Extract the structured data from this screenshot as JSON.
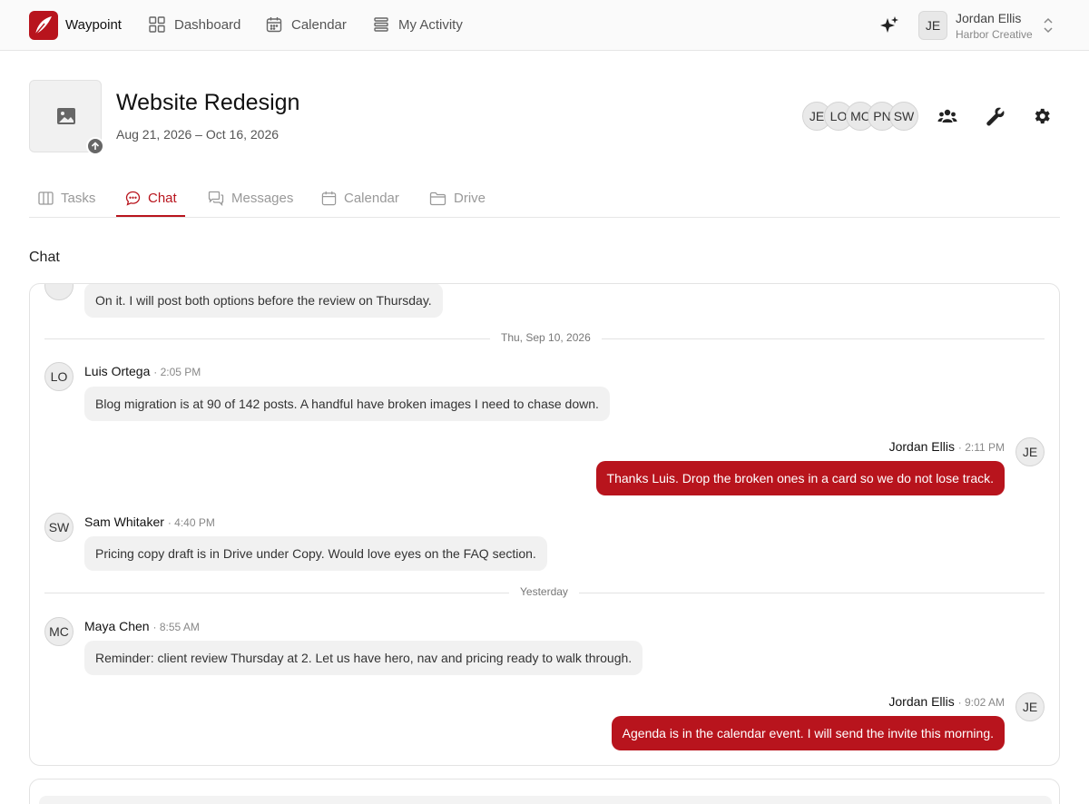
{
  "app": {
    "brand": "Waypoint",
    "accent_color": "#b8141d"
  },
  "nav": {
    "items": [
      {
        "label": "Dashboard",
        "icon": "grid-icon"
      },
      {
        "label": "Calendar",
        "icon": "calendar-icon"
      },
      {
        "label": "My Activity",
        "icon": "list-icon"
      }
    ]
  },
  "user": {
    "initials": "JE",
    "name": "Jordan Ellis",
    "org": "Harbor Creative"
  },
  "project": {
    "title": "Website Redesign",
    "dates": "Aug 21, 2026 – Oct 16, 2026",
    "members": [
      "JE",
      "LO",
      "MC",
      "PN",
      "SW"
    ]
  },
  "tabs": [
    {
      "label": "Tasks",
      "icon": "columns-icon",
      "active": false
    },
    {
      "label": "Chat",
      "icon": "chat-icon",
      "active": true
    },
    {
      "label": "Messages",
      "icon": "messages-icon",
      "active": false
    },
    {
      "label": "Calendar",
      "icon": "calendar-icon",
      "active": false
    },
    {
      "label": "Drive",
      "icon": "folder-icon",
      "active": false
    }
  ],
  "chat": {
    "section_title": "Chat",
    "dates": [
      "Thu, Sep 10, 2026",
      "Yesterday"
    ],
    "messages": [
      {
        "initials": "",
        "name": "",
        "time": "",
        "text": "On it. I will post both options before the review on Thursday.",
        "outgoing": false
      },
      {
        "initials": "LO",
        "name": "Luis Ortega",
        "time": "· 2:05 PM",
        "text": "Blog migration is at 90 of 142 posts. A handful have broken images I need to chase down.",
        "outgoing": false
      },
      {
        "initials": "JE",
        "name": "Jordan Ellis",
        "time": "· 2:11 PM",
        "text": "Thanks Luis. Drop the broken ones in a card so we do not lose track.",
        "outgoing": true
      },
      {
        "initials": "SW",
        "name": "Sam Whitaker",
        "time": "· 4:40 PM",
        "text": "Pricing copy draft is in Drive under Copy. Would love eyes on the FAQ section.",
        "outgoing": false
      },
      {
        "initials": "MC",
        "name": "Maya Chen",
        "time": "· 8:55 AM",
        "text": "Reminder: client review Thursday at 2. Let us have hero, nav and pricing ready to walk through.",
        "outgoing": false
      },
      {
        "initials": "JE",
        "name": "Jordan Ellis",
        "time": "· 9:02 AM",
        "text": "Agenda is in the calendar event. I will send the invite this morning.",
        "outgoing": true
      }
    ]
  }
}
